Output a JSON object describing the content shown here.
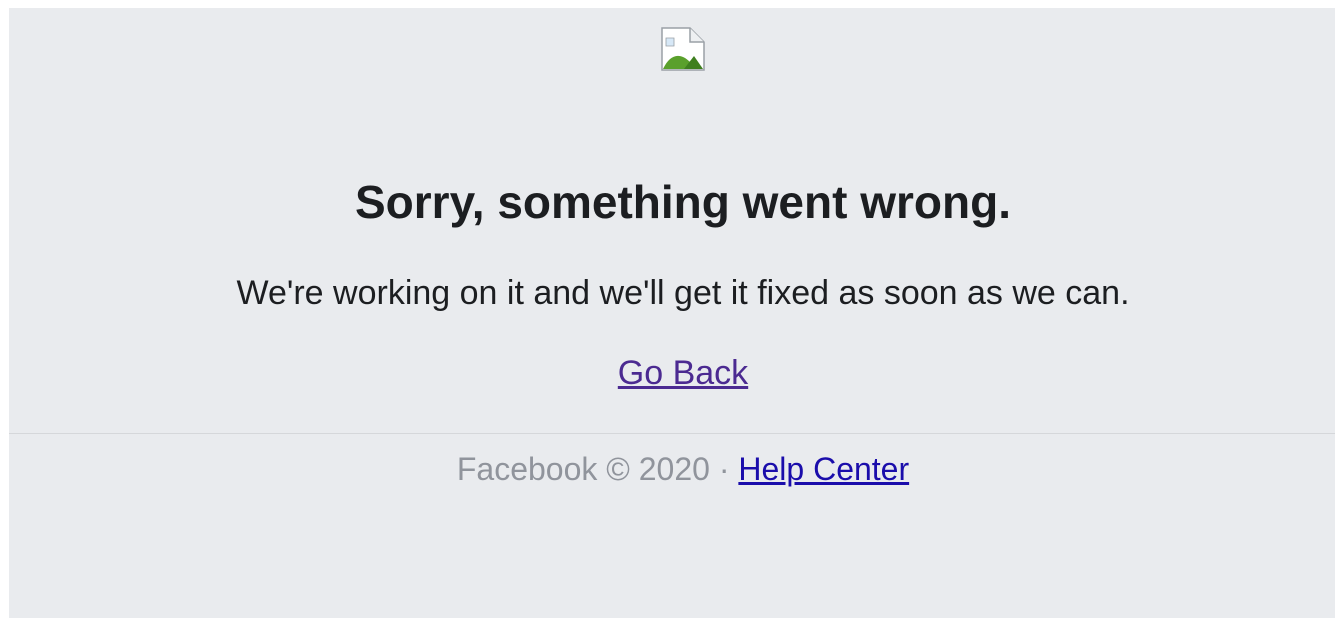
{
  "page": {
    "logo_icon": "broken-image-icon",
    "headline": "Sorry, something went wrong.",
    "subtext": "We're working on it and we'll get it fixed as soon as we can.",
    "back_link": "Go Back"
  },
  "footer": {
    "brand": "Facebook",
    "copyright": "©",
    "year": "2020",
    "separator": "·",
    "help_link": "Help Center"
  },
  "colors": {
    "background": "#e9ebee",
    "headline": "#1c1e21",
    "visited_link": "#4b2a91",
    "link": "#1a0dab",
    "footer_text": "#90949c"
  }
}
